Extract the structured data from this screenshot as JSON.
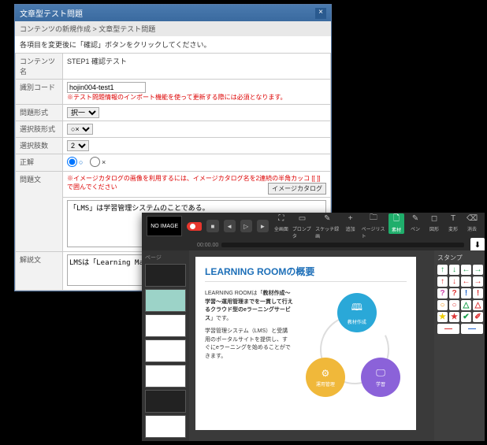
{
  "dialog": {
    "title": "文章型テスト問題",
    "subtitle": "コンテンツの新規作成 > 文章型テスト問題",
    "instruction": "各項目を変更後に「確認」ボタンをクリックしてください。",
    "rows": {
      "contents_name": {
        "label": "コンテンツ名",
        "value": "STEP1 確認テスト"
      },
      "id_code": {
        "label": "識別コード",
        "value": "hojin004-test1",
        "warn": "※テスト問題情報のインポート機能を使って更新する際には必須となります。"
      },
      "q_format": {
        "label": "問題形式",
        "value": "択一"
      },
      "opt_format": {
        "label": "選択肢形式",
        "value": "○×"
      },
      "opt_count": {
        "label": "選択肢数",
        "value": "2"
      },
      "answer": {
        "label": "正解",
        "opt_o": "○",
        "opt_x": "×"
      },
      "catalog": {
        "warn": "※イメージカタログの画像を利用するには、イメージカタログ名を2連続の半角カッコ [[ ]] で囲んでください",
        "btn": "イメージカタログ"
      },
      "q_body": {
        "label": "問題文",
        "value": "「LMS」は学習管理システムのことである。"
      },
      "exp_body": {
        "label": "解説文",
        "value": "LMSは「Learning Management System」の略称です。"
      }
    }
  },
  "editor": {
    "no_image": "NO IMAGE",
    "rec": "●",
    "timeline_label": "00:00.00",
    "tools": [
      {
        "icon": "⛶",
        "label": "全画面"
      },
      {
        "icon": "▭",
        "label": "プロンプタ"
      },
      {
        "icon": "✎",
        "label": "スケッチ録画"
      },
      {
        "icon": "+",
        "label": "追加"
      },
      {
        "icon": "🗀",
        "label": "ページリスト"
      },
      {
        "icon": "🗋",
        "label": "素材",
        "active": true
      },
      {
        "icon": "✎",
        "label": "ペン"
      },
      {
        "icon": "◻",
        "label": "図形"
      },
      {
        "icon": "T",
        "label": "変形"
      },
      {
        "icon": "⌫",
        "label": "消去"
      }
    ],
    "thumbs_header": "ページ",
    "stamps_header": "スタンプ",
    "slide": {
      "title": "LEARNING ROOMの概要",
      "p1a": "LEARNING ROOMは「",
      "p1b": "教材作成～学習～運用管理までを一貫して行えるクラウド型のeラーニングサービス",
      "p1c": "」です。",
      "p2": "学習管理システム（LMS）と受講用のポータルサイトを提供し、すぐにeラーニングを始めることができます。",
      "circ_blue": "教材作成",
      "circ_yellow": "運用管理",
      "circ_purple": "学習"
    },
    "stamps": [
      {
        "t": "↑",
        "c": "#1a9e4b"
      },
      {
        "t": "↓",
        "c": "#1a9e4b"
      },
      {
        "t": "←",
        "c": "#1a9e4b"
      },
      {
        "t": "→",
        "c": "#1a9e4b"
      },
      {
        "t": "↑",
        "c": "#d33"
      },
      {
        "t": "↓",
        "c": "#d33"
      },
      {
        "t": "←",
        "c": "#d33"
      },
      {
        "t": "→",
        "c": "#d33"
      },
      {
        "t": "?",
        "c": "#c4a"
      },
      {
        "t": "?",
        "c": "#d33"
      },
      {
        "t": "!",
        "c": "#26c"
      },
      {
        "t": "!",
        "c": "#d33"
      },
      {
        "t": "○",
        "c": "#e80"
      },
      {
        "t": "○",
        "c": "#d33"
      },
      {
        "t": "△",
        "c": "#1a9e4b"
      },
      {
        "t": "△",
        "c": "#d33"
      },
      {
        "t": "★",
        "c": "#ec0"
      },
      {
        "t": "★",
        "c": "#d33"
      },
      {
        "t": "✔",
        "c": "#1a9e4b"
      },
      {
        "t": "✐",
        "c": "#d33"
      },
      {
        "t": "—",
        "c": "#d33",
        "wide": true
      },
      {
        "t": "—",
        "c": "#26c",
        "wide": true
      }
    ]
  }
}
